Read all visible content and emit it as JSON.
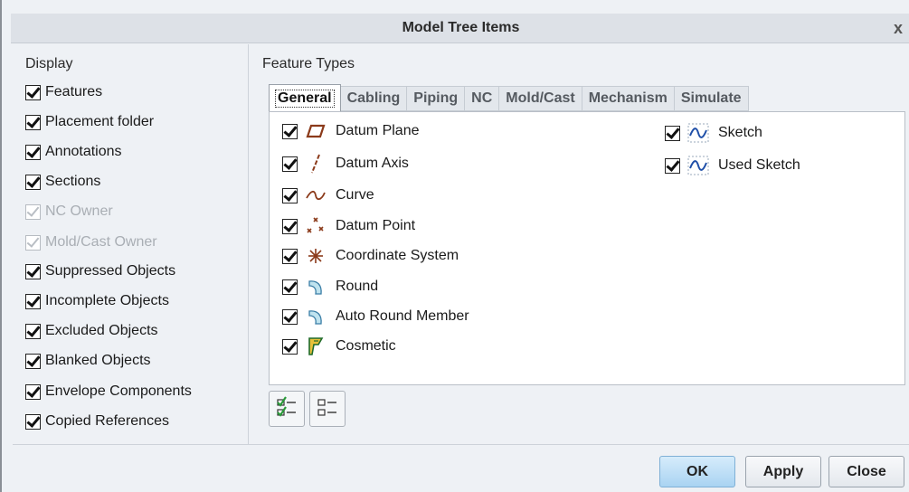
{
  "dialog": {
    "title": "Model Tree Items",
    "close_glyph": "x"
  },
  "display": {
    "label": "Display",
    "items": [
      {
        "label": "Features",
        "checked": true,
        "enabled": true
      },
      {
        "label": "Placement folder",
        "checked": true,
        "enabled": true
      },
      {
        "label": "Annotations",
        "checked": true,
        "enabled": true
      },
      {
        "label": "Sections",
        "checked": true,
        "enabled": true
      },
      {
        "label": "NC Owner",
        "checked": true,
        "enabled": false
      },
      {
        "label": "Mold/Cast Owner",
        "checked": true,
        "enabled": false
      },
      {
        "label": "Suppressed Objects",
        "checked": true,
        "enabled": true
      },
      {
        "label": "Incomplete Objects",
        "checked": true,
        "enabled": true
      },
      {
        "label": "Excluded Objects",
        "checked": true,
        "enabled": true
      },
      {
        "label": "Blanked Objects",
        "checked": true,
        "enabled": true
      },
      {
        "label": "Envelope Components",
        "checked": true,
        "enabled": true
      },
      {
        "label": "Copied References",
        "checked": true,
        "enabled": true
      }
    ]
  },
  "feature_types": {
    "label": "Feature Types",
    "tabs": [
      {
        "label": "General",
        "active": true
      },
      {
        "label": "Cabling",
        "active": false
      },
      {
        "label": "Piping",
        "active": false
      },
      {
        "label": "NC",
        "active": false
      },
      {
        "label": "Mold/Cast",
        "active": false
      },
      {
        "label": "Mechanism",
        "active": false
      },
      {
        "label": "Simulate",
        "active": false
      }
    ],
    "general_items": [
      {
        "label": "Datum Plane",
        "icon": "datum-plane-icon",
        "checked": true
      },
      {
        "label": "Datum Axis",
        "icon": "datum-axis-icon",
        "checked": true
      },
      {
        "label": "Curve",
        "icon": "curve-icon",
        "checked": true
      },
      {
        "label": "Datum Point",
        "icon": "datum-point-icon",
        "checked": true
      },
      {
        "label": "Coordinate System",
        "icon": "coordinate-system-icon",
        "checked": true
      },
      {
        "label": "Round",
        "icon": "round-icon",
        "checked": true
      },
      {
        "label": "Auto Round Member",
        "icon": "auto-round-member-icon",
        "checked": true
      },
      {
        "label": "Cosmetic",
        "icon": "cosmetic-icon",
        "checked": true
      },
      {
        "label": "Sketch",
        "icon": "sketch-icon",
        "checked": true
      },
      {
        "label": "Used Sketch",
        "icon": "used-sketch-icon",
        "checked": true
      }
    ],
    "select_all_icon": "select-all-icon",
    "deselect_all_icon": "deselect-all-icon"
  },
  "buttons": {
    "ok": "OK",
    "apply": "Apply",
    "close": "Close"
  },
  "colors": {
    "primary_button": "#a9d3f2",
    "icon_brown": "#8b3a1a",
    "icon_blue": "#1f4fa8"
  }
}
